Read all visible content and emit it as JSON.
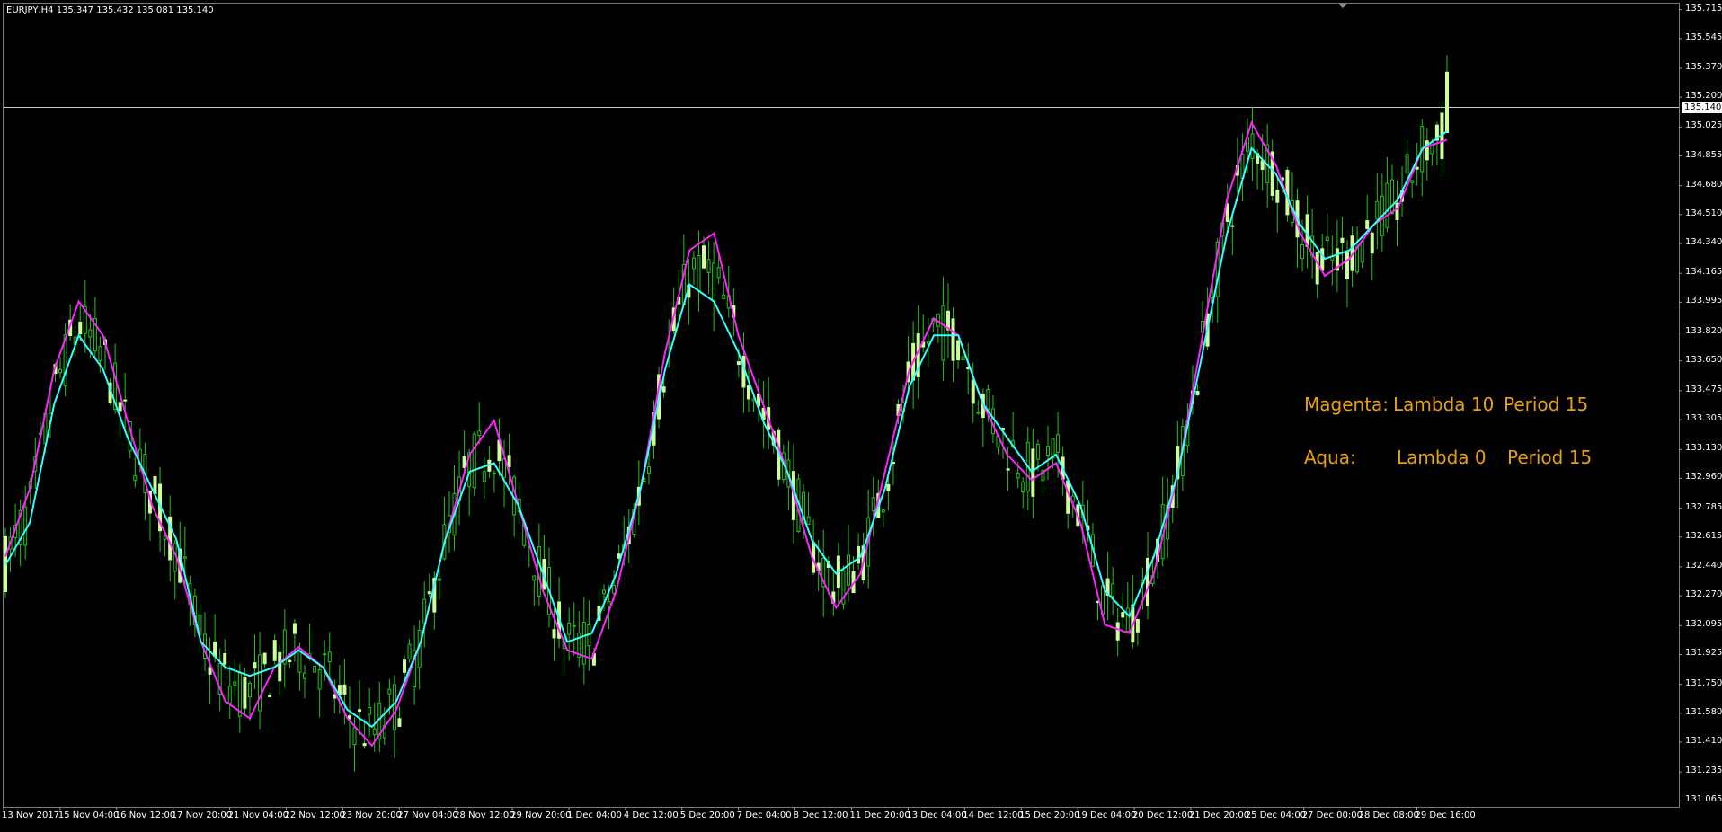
{
  "chart_title": "EURJPY,H4  135.347 135.432 135.081 135.140",
  "current_price_tag": "135.140",
  "legend": {
    "magenta": {
      "name": "Magenta:",
      "lambda": "Lambda 10",
      "period": "Period 15"
    },
    "aqua": {
      "name": "Aqua:",
      "lambda": "Lambda 0",
      "period": "Period 15"
    }
  },
  "colors": {
    "background": "#000000",
    "bull_candle": "#ccff99",
    "bear_candle_wick": "#22c41a",
    "magenta_line": "#ff22ff",
    "aqua_line": "#33ffff",
    "legend_text": "#e8a012",
    "price_line": "#c8c8d8"
  },
  "chart_data": {
    "type": "candlestick",
    "symbol": "EURJPY",
    "timeframe": "H4",
    "header_ohlc": {
      "open": 135.347,
      "high": 135.432,
      "low": 135.081,
      "close": 135.14
    },
    "current_price": 135.14,
    "y_ticks": [
      "135.715",
      "135.545",
      "135.370",
      "135.200",
      "135.025",
      "134.855",
      "134.680",
      "134.510",
      "134.340",
      "134.165",
      "133.995",
      "133.820",
      "133.650",
      "133.475",
      "133.305",
      "133.130",
      "132.960",
      "132.785",
      "132.615",
      "132.440",
      "132.270",
      "132.095",
      "131.925",
      "131.750",
      "131.580",
      "131.410",
      "131.235",
      "131.065"
    ],
    "ylim": [
      131.03,
      135.75
    ],
    "x_ticks": [
      "13 Nov 2017",
      "15 Nov 04:00",
      "16 Nov 12:00",
      "17 Nov 20:00",
      "21 Nov 04:00",
      "22 Nov 12:00",
      "23 Nov 20:00",
      "27 Nov 04:00",
      "28 Nov 12:00",
      "29 Nov 20:00",
      "1 Dec 04:00",
      "4 Dec 12:00",
      "5 Dec 20:00",
      "7 Dec 04:00",
      "8 Dec 12:00",
      "11 Dec 20:00",
      "13 Dec 04:00",
      "14 Dec 12:00",
      "15 Dec 20:00",
      "19 Dec 04:00",
      "20 Dec 12:00",
      "21 Dec 20:00",
      "25 Dec 04:00",
      "27 Dec 00:00",
      "28 Dec 08:00",
      "29 Dec 16:00"
    ],
    "series": [
      {
        "name": "Magenta: Lambda 10 Period 15",
        "color": "#ff22ff",
        "values": [
          132.5,
          132.9,
          133.6,
          134.0,
          133.8,
          133.3,
          132.8,
          132.5,
          132.0,
          131.65,
          131.55,
          131.85,
          131.97,
          131.85,
          131.55,
          131.39,
          131.6,
          132.0,
          132.6,
          133.1,
          133.3,
          132.8,
          132.3,
          131.95,
          131.9,
          132.3,
          132.9,
          133.7,
          134.3,
          134.4,
          133.8,
          133.4,
          133.0,
          132.5,
          132.2,
          132.4,
          133.0,
          133.6,
          133.9,
          133.8,
          133.4,
          133.1,
          132.95,
          133.05,
          132.7,
          132.1,
          132.05,
          132.4,
          133.0,
          133.8,
          134.6,
          135.05,
          134.8,
          134.4,
          134.15,
          134.25,
          134.45,
          134.55,
          134.9,
          134.95
        ]
      },
      {
        "name": "Aqua: Lambda 0 Period 15",
        "color": "#33ffff",
        "values": [
          132.45,
          132.7,
          133.4,
          133.8,
          133.6,
          133.2,
          132.9,
          132.6,
          132.0,
          131.85,
          131.8,
          131.85,
          131.95,
          131.85,
          131.6,
          131.5,
          131.65,
          132.0,
          132.6,
          133.0,
          133.05,
          132.8,
          132.4,
          132.0,
          132.05,
          132.4,
          132.9,
          133.6,
          134.1,
          134.0,
          133.7,
          133.3,
          133.0,
          132.6,
          132.4,
          132.5,
          132.9,
          133.5,
          133.8,
          133.8,
          133.4,
          133.2,
          133.0,
          133.1,
          132.8,
          132.3,
          132.15,
          132.5,
          133.0,
          133.7,
          134.4,
          134.9,
          134.75,
          134.45,
          134.25,
          134.3,
          134.45,
          134.6,
          134.9,
          135.0
        ]
      }
    ]
  }
}
